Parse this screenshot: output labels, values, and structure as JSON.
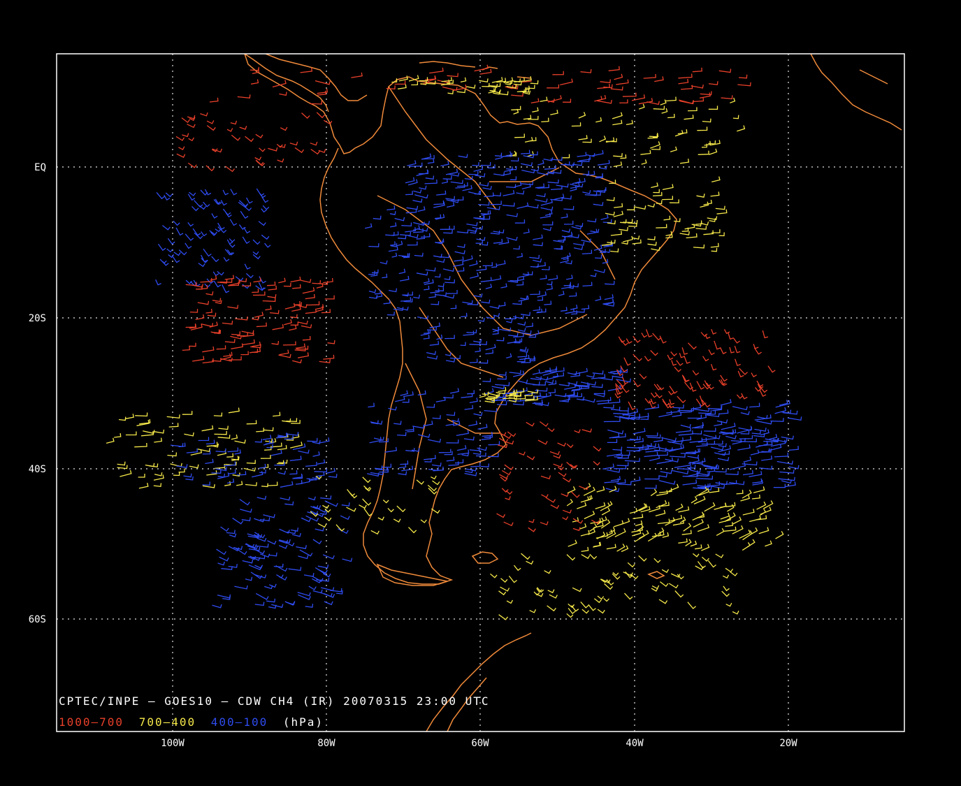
{
  "map": {
    "caption": "CPTEC/INPE — GOES10 — CDW CH4 (IR) 20070315 23:00 UTC",
    "legend": [
      {
        "label": "1000—700",
        "color": "#e8402a"
      },
      {
        "label": "700—400",
        "color": "#f5e84a"
      },
      {
        "label": "400—100",
        "color": "#2f4cf0"
      },
      {
        "label": "(hPa)",
        "color": "#ffffff"
      }
    ],
    "lon_ticks": [
      "100W",
      "80W",
      "60W",
      "40W",
      "20W"
    ],
    "lat_ticks": [
      "EQ",
      "20S",
      "40S",
      "60S"
    ],
    "colors": {
      "coast": "#f08a3a",
      "frame": "#ffffff",
      "grid": "#ffffff",
      "low": "#e8402a",
      "mid": "#f5e84a",
      "high": "#2f4cf0"
    }
  }
}
